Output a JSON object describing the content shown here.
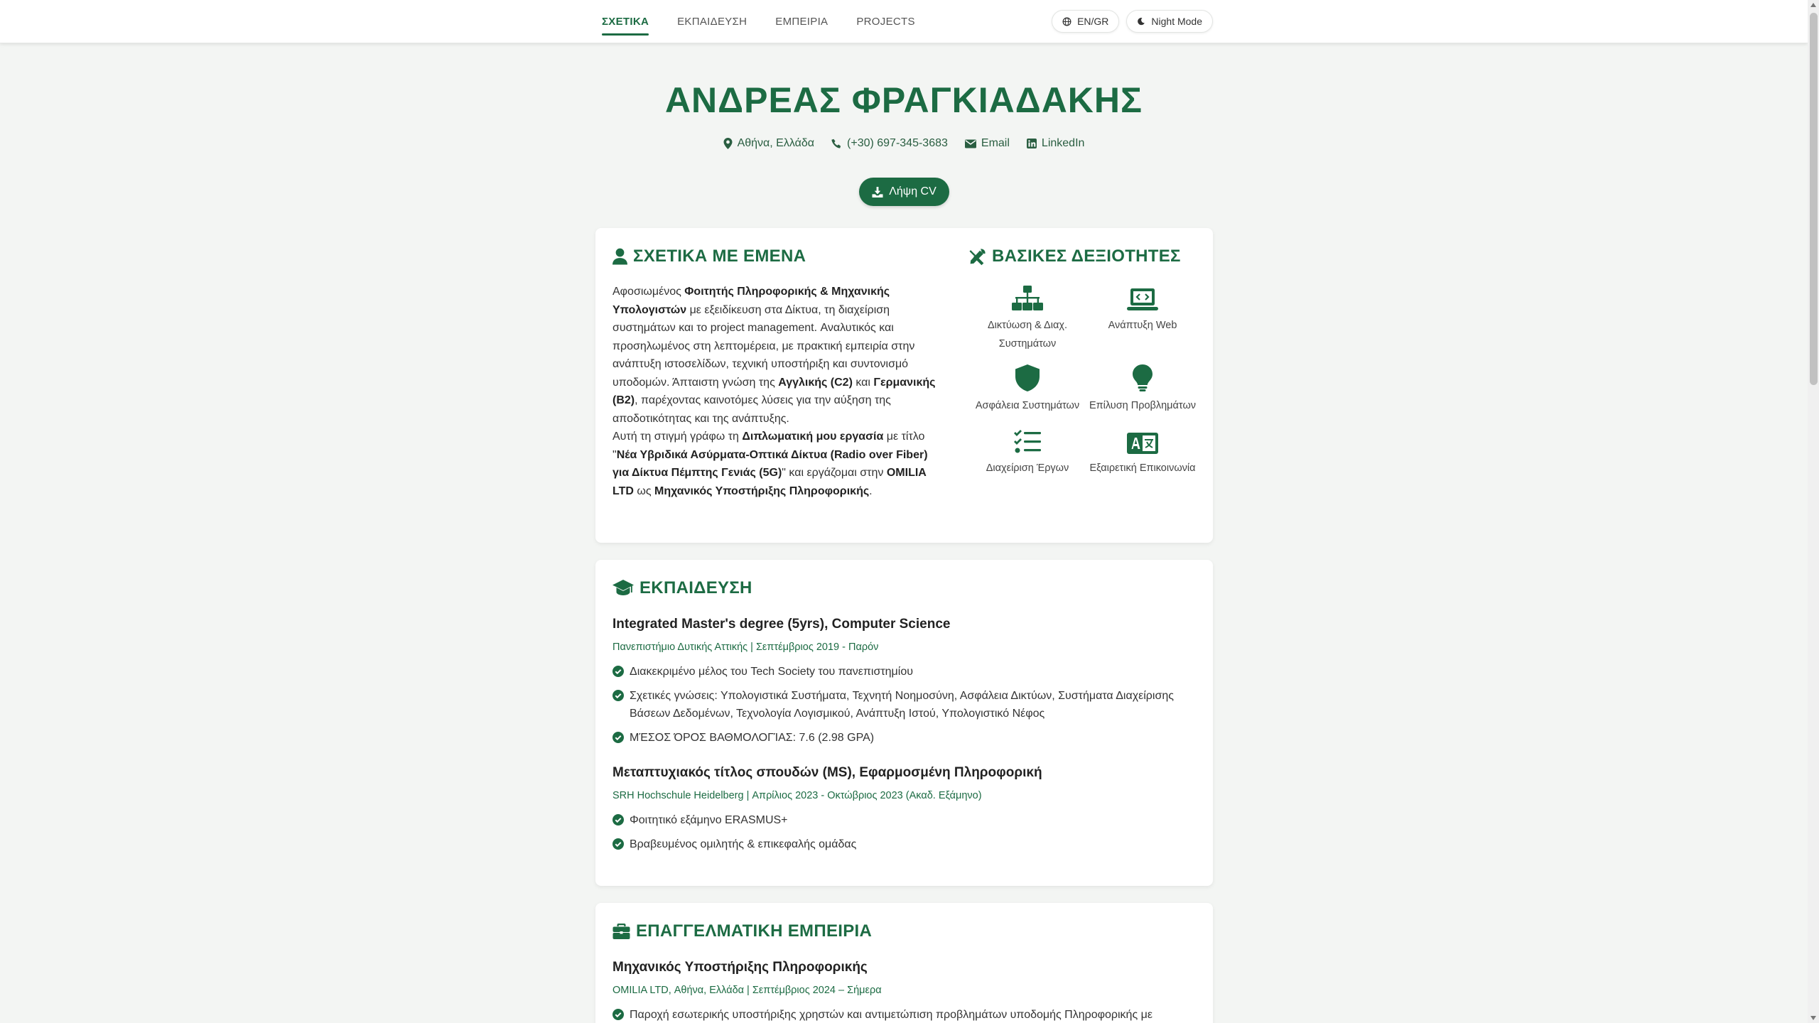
{
  "nav": {
    "items": [
      {
        "label": "ΣΧΕΤΙΚΑ",
        "active": true
      },
      {
        "label": "ΕΚΠΑΙΔΕΥΣΗ",
        "active": false
      },
      {
        "label": "ΕΜΠΕΙΡΙΑ",
        "active": false
      },
      {
        "label": "PROJECTS",
        "active": false
      }
    ],
    "lang_label": "EN/GR",
    "night_label": "Night Mode"
  },
  "hero": {
    "name": "ΑΝΔΡΕΑΣ ΦΡΑΓΚΙΑΔΑΚΗΣ",
    "location": "Αθήνα, Ελλάδα",
    "phone": "(+30) 697-345-3683",
    "email_label": "Email",
    "linkedin_label": "LinkedIn",
    "cv_label": "Λήψη CV"
  },
  "about": {
    "title": "ΣΧΕΤΙΚΑ ΜΕ ΕΜΕΝΑ",
    "p1": [
      {
        "t": "Αφοσιωμένος "
      },
      {
        "t": "Φοιτητής Πληροφορικής & Μηχανικής Υπολογιστών",
        "b": true
      },
      {
        "t": " με εξειδίκευση στα Δίκτυα, τη διαχείριση συστημάτων και το project management. Αναλυτικός και προσηλωμένος στη λεπτομέρεια, με πρακτική εμπειρία στην ανάπτυξη ιστοσελίδων, τεχνική υποστήριξη και συντονισμό υποδομών. Άπταιστη γνώση της "
      },
      {
        "t": "Αγγλικής (C2)",
        "b": true
      },
      {
        "t": " και "
      },
      {
        "t": "Γερμανικής (B2)",
        "b": true
      },
      {
        "t": ", παρέχοντας καινοτόμες λύσεις για την αύξηση της αποδοτικότητας και της ανάπτυξης."
      }
    ],
    "p2": [
      {
        "t": "Αυτή τη στιγμή γράφω τη "
      },
      {
        "t": "Διπλωματική μου εργασία",
        "b": true
      },
      {
        "t": " με τίτλο \""
      },
      {
        "t": "Νέα Υβριδικά Ασύρματα-Οπτικά Δίκτυα (Radio over Fiber) για Δίκτυα Πέμπτης Γενιάς (5G)",
        "b": true
      },
      {
        "t": "\" και εργάζομαι στην "
      },
      {
        "t": "OMILIA LTD",
        "b": true
      },
      {
        "t": " ως "
      },
      {
        "t": "Μηχανικός Υποστήριξης Πληροφορικής",
        "b": true
      },
      {
        "t": "."
      }
    ]
  },
  "skills": {
    "title": "ΒΑΣΙΚΕΣ ΔΕΞΙΟΤΗΤΕΣ",
    "items": [
      {
        "label": "Δικτύωση & Διαχ. Συστημάτων",
        "icon": "network-icon"
      },
      {
        "label": "Ανάπτυξη Web",
        "icon": "laptop-code-icon"
      },
      {
        "label": "Ασφάλεια Συστημάτων",
        "icon": "shield-icon"
      },
      {
        "label": "Επίλυση Προβλημάτων",
        "icon": "lightbulb-icon"
      },
      {
        "label": "Διαχείριση Έργων",
        "icon": "list-check-icon"
      },
      {
        "label": "Εξαιρετική Επικοινωνία",
        "icon": "language-icon"
      }
    ]
  },
  "education": {
    "title": "ΕΚΠΑΙΔΕΥΣΗ",
    "entries": [
      {
        "title": "Integrated Master's degree (5yrs), Computer Science",
        "meta": "Πανεπιστήμιο Δυτικής Αττικής | Σεπτέμβριος 2019 - Παρόν",
        "bullets": [
          "Διακεκριμένο μέλος του Tech Society του πανεπιστημίου",
          "Σχετικές γνώσεις: Υπολογιστικά Συστήματα, Τεχνητή Νοημοσύνη, Ασφάλεια Δικτύων, Συστήματα Διαχείρισης Βάσεων Δεδομένων, Τεχνολογία Λογισμικού, Ανάπτυξη Ιστού, Υπολογιστικό Νέφος",
          "ΜΈΣΟΣ ΌΡΟΣ ΒΑΘΜΟΛΟΓΊΑΣ: 7.6 (2.98 GPA)"
        ]
      },
      {
        "title": "Μεταπτυχιακός τίτλος σπουδών (MS), Εφαρμοσμένη Πληροφορική",
        "meta": "SRH Hochschule Heidelberg | Απρίλιος 2023 - Οκτώβριος 2023 (Ακαδ. Εξάμηνο)",
        "bullets": [
          "Φοιτητικό εξάμηνο ERASMUS+",
          "Βραβευμένος ομιλητής & επικεφαλής ομάδας"
        ]
      }
    ]
  },
  "experience": {
    "title": "ΕΠΑΓΓΕΛΜΑΤΙΚΗ ΕΜΠΕΙΡΙΑ",
    "entries": [
      {
        "title": "Μηχανικός Υποστήριξης Πληροφορικής",
        "meta": "OMILIA LTD, Αθήνα, Ελλάδα | Σεπτέμβριος 2024 – Σήμερα",
        "bullets": [
          "Παροχή εσωτερικής υποστήριξης χρηστών και αντιμετώπιση προβλημάτων υποδομής Πληροφορικής με"
        ]
      }
    ]
  },
  "colors": {
    "accent": "#1c6b43",
    "background": "#f3f5f3"
  }
}
